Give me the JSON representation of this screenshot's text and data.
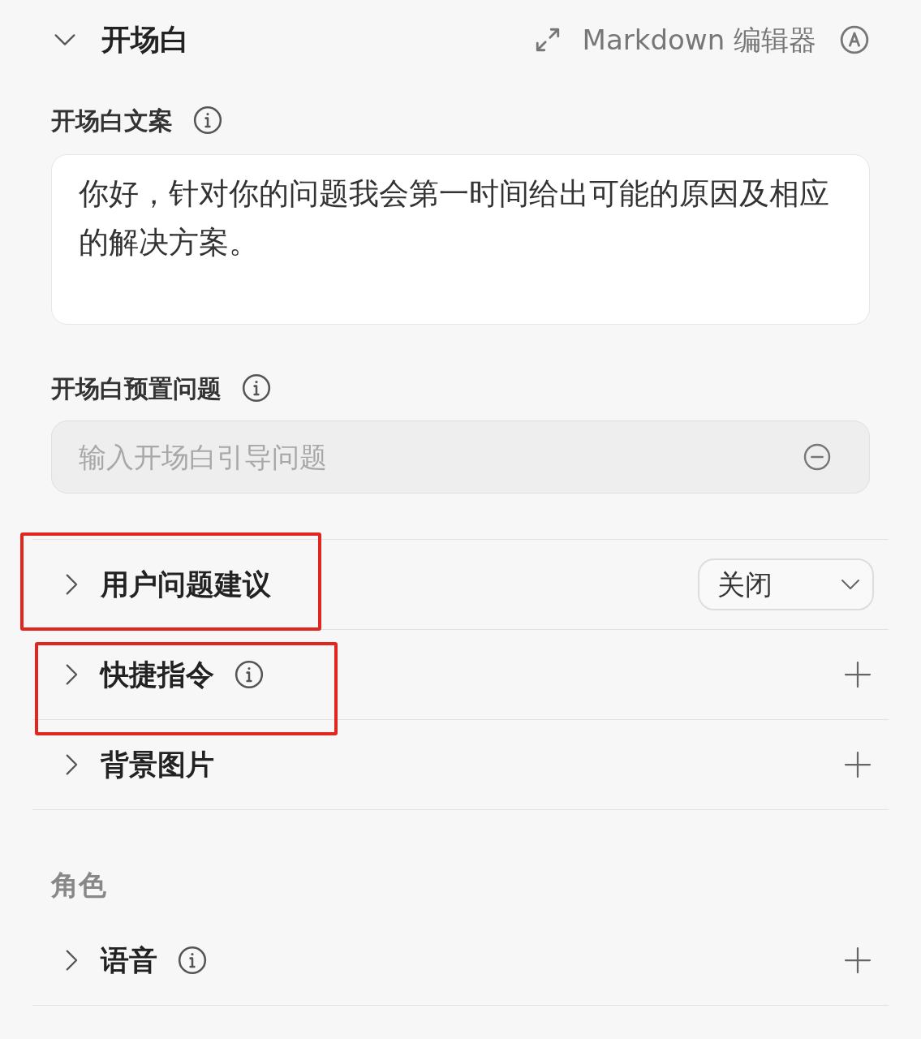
{
  "header": {
    "title": "开场白",
    "expanded": true,
    "editor_label": "Markdown 编辑器"
  },
  "opening_text": {
    "label": "开场白文案",
    "info": true,
    "value": "你好，针对你的问题我会第一时间给出可能的原因及相应的解决方案。"
  },
  "preset_questions": {
    "label": "开场白预置问题",
    "info": true,
    "placeholder": "输入开场白引导问题"
  },
  "sections": [
    {
      "title": "用户问题建议",
      "kind": "select",
      "expanded": false,
      "info": false,
      "highlighted": true,
      "value": "关闭"
    },
    {
      "title": "快捷指令",
      "kind": "add",
      "expanded": false,
      "info": true,
      "highlighted": true
    },
    {
      "title": "背景图片",
      "kind": "add",
      "expanded": false,
      "info": false,
      "highlighted": false
    }
  ],
  "role_group": {
    "label": "角色",
    "sections": [
      {
        "title": "语音",
        "kind": "add",
        "expanded": false,
        "info": true,
        "highlighted": false
      }
    ]
  }
}
